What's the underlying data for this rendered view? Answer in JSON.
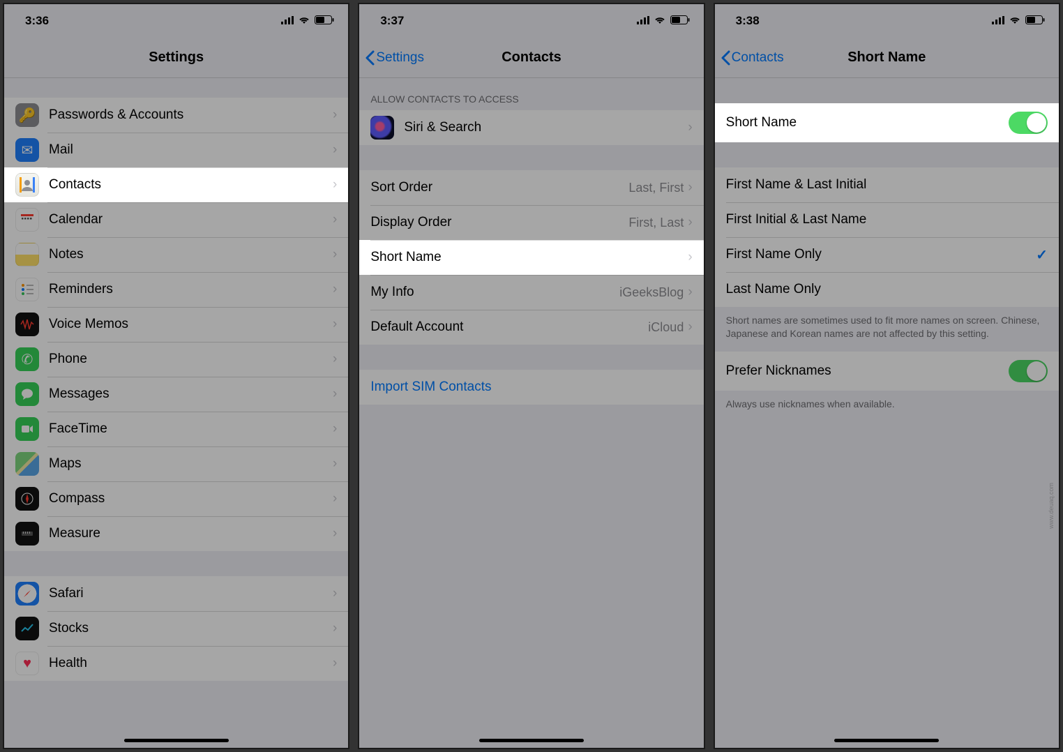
{
  "watermark": "www.deuaq.com",
  "screens": [
    {
      "time": "3:36",
      "title": "Settings",
      "back": null,
      "rows": [
        {
          "icon": "key-icon",
          "label": "Passwords & Accounts"
        },
        {
          "icon": "mail-icon",
          "label": "Mail"
        },
        {
          "icon": "contacts-icon",
          "label": "Contacts",
          "highlight": true
        },
        {
          "icon": "calendar-icon",
          "label": "Calendar"
        },
        {
          "icon": "notes-icon",
          "label": "Notes"
        },
        {
          "icon": "reminders-icon",
          "label": "Reminders"
        },
        {
          "icon": "voice-memos-icon",
          "label": "Voice Memos"
        },
        {
          "icon": "phone-icon",
          "label": "Phone"
        },
        {
          "icon": "messages-icon",
          "label": "Messages"
        },
        {
          "icon": "facetime-icon",
          "label": "FaceTime"
        },
        {
          "icon": "maps-icon",
          "label": "Maps"
        },
        {
          "icon": "compass-icon",
          "label": "Compass"
        },
        {
          "icon": "measure-icon",
          "label": "Measure"
        },
        {
          "icon": "safari-icon",
          "label": "Safari"
        },
        {
          "icon": "stocks-icon",
          "label": "Stocks"
        },
        {
          "icon": "health-icon",
          "label": "Health"
        }
      ]
    },
    {
      "time": "3:37",
      "title": "Contacts",
      "back": "Settings",
      "section_header": "ALLOW CONTACTS TO ACCESS",
      "siri_label": "Siri & Search",
      "rows": [
        {
          "label": "Sort Order",
          "detail": "Last, First"
        },
        {
          "label": "Display Order",
          "detail": "First, Last"
        },
        {
          "label": "Short Name",
          "highlight": true
        },
        {
          "label": "My Info",
          "detail": "iGeeksBlog"
        },
        {
          "label": "Default Account",
          "detail": "iCloud"
        }
      ],
      "import_label": "Import SIM Contacts"
    },
    {
      "time": "3:38",
      "title": "Short Name",
      "back": "Contacts",
      "toggle_label": "Short Name",
      "toggle_on": true,
      "options": [
        {
          "label": "First Name & Last Initial",
          "selected": false
        },
        {
          "label": "First Initial & Last Name",
          "selected": false
        },
        {
          "label": "First Name Only",
          "selected": true
        },
        {
          "label": "Last Name Only",
          "selected": false
        }
      ],
      "options_footer": "Short names are sometimes used to fit more names on screen. Chinese, Japanese and Korean names are not affected by this setting.",
      "nickname_label": "Prefer Nicknames",
      "nickname_on": true,
      "nickname_footer": "Always use nicknames when available."
    }
  ]
}
